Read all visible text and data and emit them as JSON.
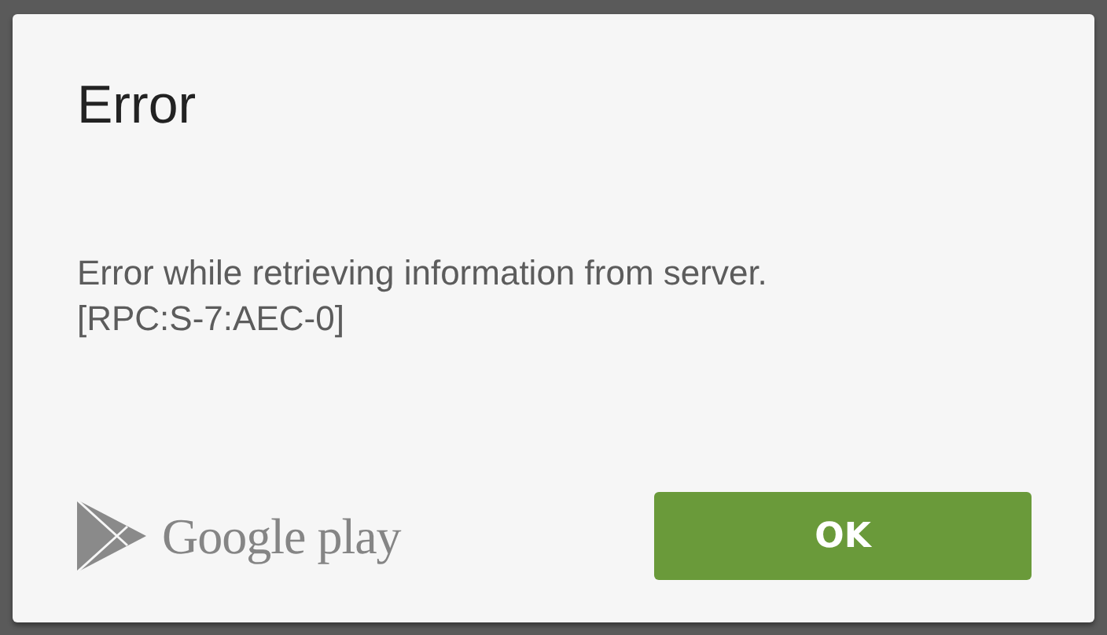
{
  "dialog": {
    "title": "Error",
    "message_lines": [
      "Error while retrieving information from server.",
      "[RPC:S-7:AEC-0]"
    ],
    "brand": {
      "name": "Google",
      "product": "play"
    },
    "buttons": [
      "OK"
    ]
  }
}
